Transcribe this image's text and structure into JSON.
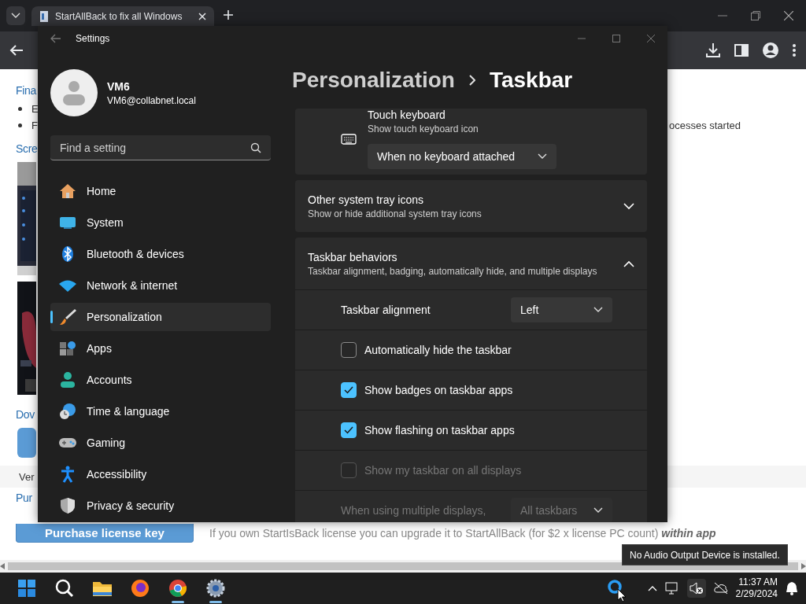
{
  "browser": {
    "tab_title": "StartAllBack to fix all Windows",
    "page": {
      "heading_1": "Fina",
      "bullets": [
        {
          "text": "E"
        },
        {
          "text": "F",
          "continuation": "ocesses started"
        }
      ],
      "heading_2": "Scre",
      "heading_3": "Dov",
      "version_label": "Ver",
      "heading_4": "Pur",
      "purchase_button": "Purchase license key",
      "purchase_note": "If you own StartIsBack license you can upgrade it to StartAllBack (for $2 x license PC count) **within app**"
    }
  },
  "settings": {
    "title": "Settings",
    "user": {
      "name": "VM6",
      "email": "VM6@collabnet.local"
    },
    "search": {
      "placeholder": "Find a setting"
    },
    "nav": [
      {
        "label": "Home",
        "selected": false
      },
      {
        "label": "System",
        "selected": false
      },
      {
        "label": "Bluetooth & devices",
        "selected": false
      },
      {
        "label": "Network & internet",
        "selected": false
      },
      {
        "label": "Personalization",
        "selected": true
      },
      {
        "label": "Apps",
        "selected": false
      },
      {
        "label": "Accounts",
        "selected": false
      },
      {
        "label": "Time & language",
        "selected": false
      },
      {
        "label": "Gaming",
        "selected": false
      },
      {
        "label": "Accessibility",
        "selected": false
      },
      {
        "label": "Privacy & security",
        "selected": false
      }
    ],
    "breadcrumb": {
      "parent": "Personalization",
      "current": "Taskbar"
    },
    "sections": [
      {
        "kind": "setting",
        "title": "Touch keyboard",
        "subtitle": "Show touch keyboard icon",
        "dropdown": "When no keyboard attached"
      },
      {
        "kind": "expander",
        "title": "Other system tray icons",
        "subtitle": "Show or hide additional system tray icons",
        "expanded": false
      },
      {
        "kind": "expander",
        "title": "Taskbar behaviors",
        "subtitle": "Taskbar alignment, badging, automatically hide, and multiple displays",
        "expanded": true,
        "rows": [
          {
            "kind": "dropdown",
            "label": "Taskbar alignment",
            "value": "Left",
            "disabled": false
          },
          {
            "kind": "checkbox",
            "label": "Automatically hide the taskbar",
            "checked": false,
            "disabled": false
          },
          {
            "kind": "checkbox",
            "label": "Show badges on taskbar apps",
            "checked": true,
            "disabled": false
          },
          {
            "kind": "checkbox",
            "label": "Show flashing on taskbar apps",
            "checked": true,
            "disabled": false
          },
          {
            "kind": "checkbox",
            "label": "Show my taskbar on all displays",
            "checked": false,
            "disabled": true
          },
          {
            "kind": "dropdown",
            "label": "When using multiple displays,",
            "value": "All taskbars",
            "disabled": true
          }
        ]
      }
    ]
  },
  "taskbar": {
    "apps": [
      {
        "running": false
      },
      {
        "running": false
      },
      {
        "running": false
      },
      {
        "running": false
      },
      {
        "running": true
      },
      {
        "running": true
      }
    ],
    "clock": {
      "time": "11:37 AM",
      "date": "2/29/2024"
    },
    "tooltip": "No Audio Output Device is installed."
  }
}
